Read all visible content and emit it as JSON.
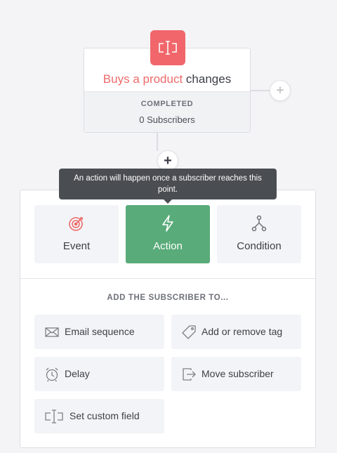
{
  "trigger": {
    "title_highlight": "Buys a product",
    "title_rest": " changes",
    "status": "COMPLETED",
    "subscribers": "0 Subscribers"
  },
  "add_step": {
    "symbol": "+"
  },
  "tooltip": {
    "text": "An action will happen once a subscriber reaches this point."
  },
  "tabs": [
    {
      "label": "Event",
      "icon": "target-icon",
      "active": false
    },
    {
      "label": "Action",
      "icon": "lightning-icon",
      "active": true
    },
    {
      "label": "Condition",
      "icon": "branch-icon",
      "active": false
    }
  ],
  "section": {
    "heading": "ADD THE SUBSCRIBER TO..."
  },
  "actions": [
    {
      "label": "Email sequence",
      "icon": "envelope-icon"
    },
    {
      "label": "Add or remove tag",
      "icon": "tag-icon"
    },
    {
      "label": "Delay",
      "icon": "alarm-clock-icon"
    },
    {
      "label": "Move subscriber",
      "icon": "move-out-icon"
    },
    {
      "label": "Set custom field",
      "icon": "text-cursor-field-icon"
    }
  ],
  "colors": {
    "accent_red": "#f0666a",
    "action_green": "#59ab79",
    "tooltip_bg": "#4a4d52"
  }
}
